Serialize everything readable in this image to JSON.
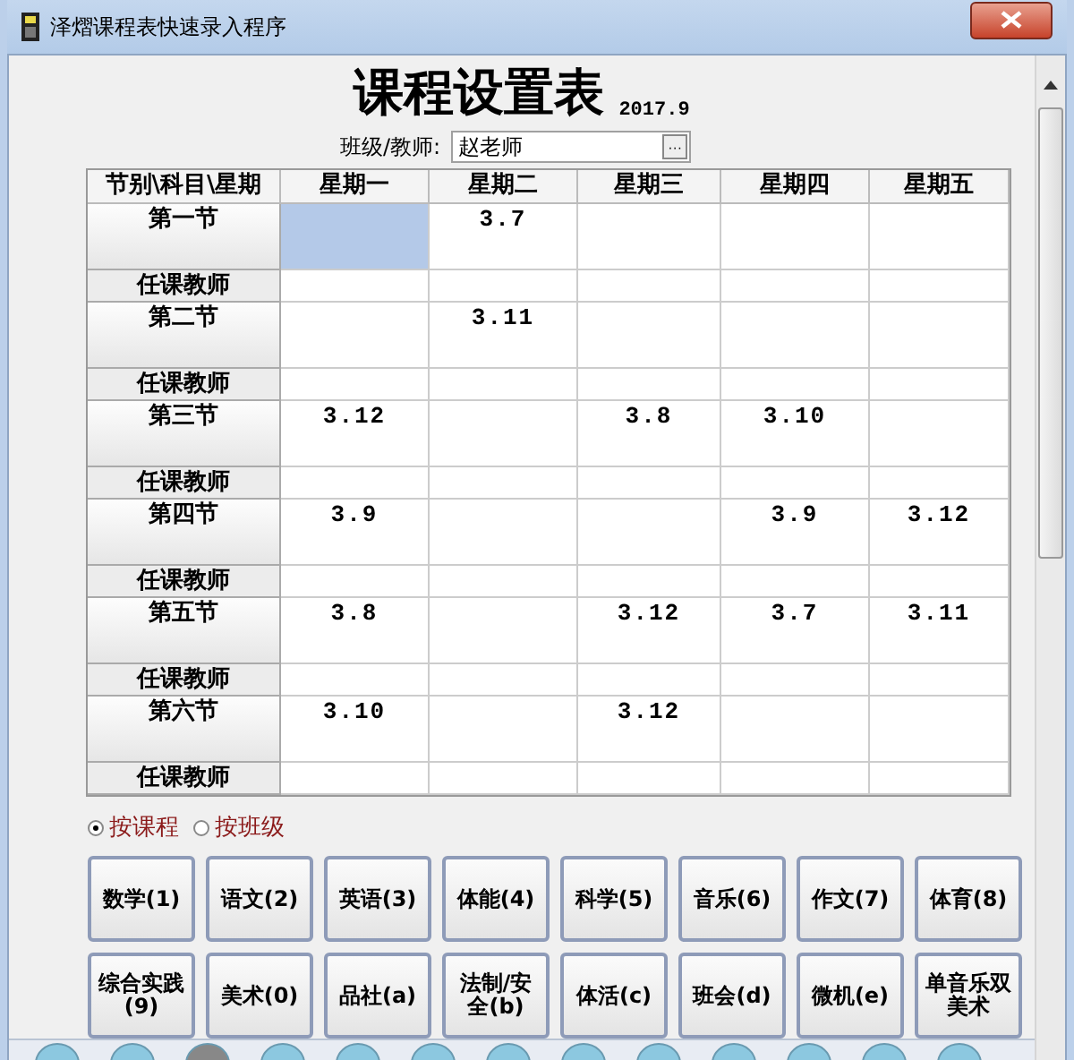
{
  "window": {
    "title": "泽熠课程表快速录入程序"
  },
  "heading": {
    "title": "课程设置表",
    "date": "2017.9"
  },
  "class_field": {
    "label": "班级/教师:",
    "value": "赵老师",
    "button": "···"
  },
  "table": {
    "corner": "节别\\科目\\星期",
    "columns": [
      "星期一",
      "星期二",
      "星期三",
      "星期四",
      "星期五"
    ],
    "periods": [
      {
        "name": "第一节",
        "teacher_label": "任课教师",
        "cells": [
          {
            "selected": true
          },
          {
            "text": "3.7",
            "selected": false
          },
          {
            "selected": false
          },
          {
            "selected": false
          },
          {
            "selected": false
          }
        ]
      },
      {
        "name": "第二节",
        "teacher_label": "任课教师",
        "cells": [
          {
            "selected": false
          },
          {
            "text": "3.11",
            "selected": false
          },
          {
            "selected": false
          },
          {
            "selected": false
          },
          {
            "selected": false
          }
        ]
      },
      {
        "name": "第三节",
        "teacher_label": "任课教师",
        "cells": [
          {
            "text": "3.12",
            "selected": false
          },
          {
            "selected": false
          },
          {
            "text": "3.8",
            "selected": false
          },
          {
            "text": "3.10",
            "selected": false
          },
          {
            "selected": false
          }
        ]
      },
      {
        "name": "第四节",
        "teacher_label": "任课教师",
        "cells": [
          {
            "text": "3.9",
            "selected": false
          },
          {
            "selected": false
          },
          {
            "selected": false
          },
          {
            "text": "3.9",
            "selected": false
          },
          {
            "text": "3.12",
            "selected": false
          }
        ]
      },
      {
        "name": "第五节",
        "teacher_label": "任课教师",
        "cells": [
          {
            "text": "3.8",
            "selected": false
          },
          {
            "selected": false
          },
          {
            "text": "3.12",
            "selected": false
          },
          {
            "text": "3.7",
            "selected": false
          },
          {
            "text": "3.11",
            "selected": false
          }
        ]
      },
      {
        "name": "第六节",
        "teacher_label": "任课教师",
        "cells": [
          {
            "text": "3.10",
            "selected": false
          },
          {
            "selected": false
          },
          {
            "text": "3.12",
            "selected": false
          },
          {
            "selected": false
          },
          {
            "selected": false
          }
        ]
      }
    ]
  },
  "mode_options": [
    {
      "label": "按课程",
      "selected": true
    },
    {
      "label": "按班级",
      "selected": false
    }
  ],
  "subject_buttons": [
    "数学(1)",
    "语文(2)",
    "英语(3)",
    "体能(4)",
    "科学(5)",
    "音乐(6)",
    "作文(7)",
    "体育(8)",
    "综合实践(9)",
    "美术(0)",
    "品社(a)",
    "法制/安全(b)",
    "体活(c)",
    "班会(d)",
    "微机(e)",
    "单音乐双美术"
  ]
}
